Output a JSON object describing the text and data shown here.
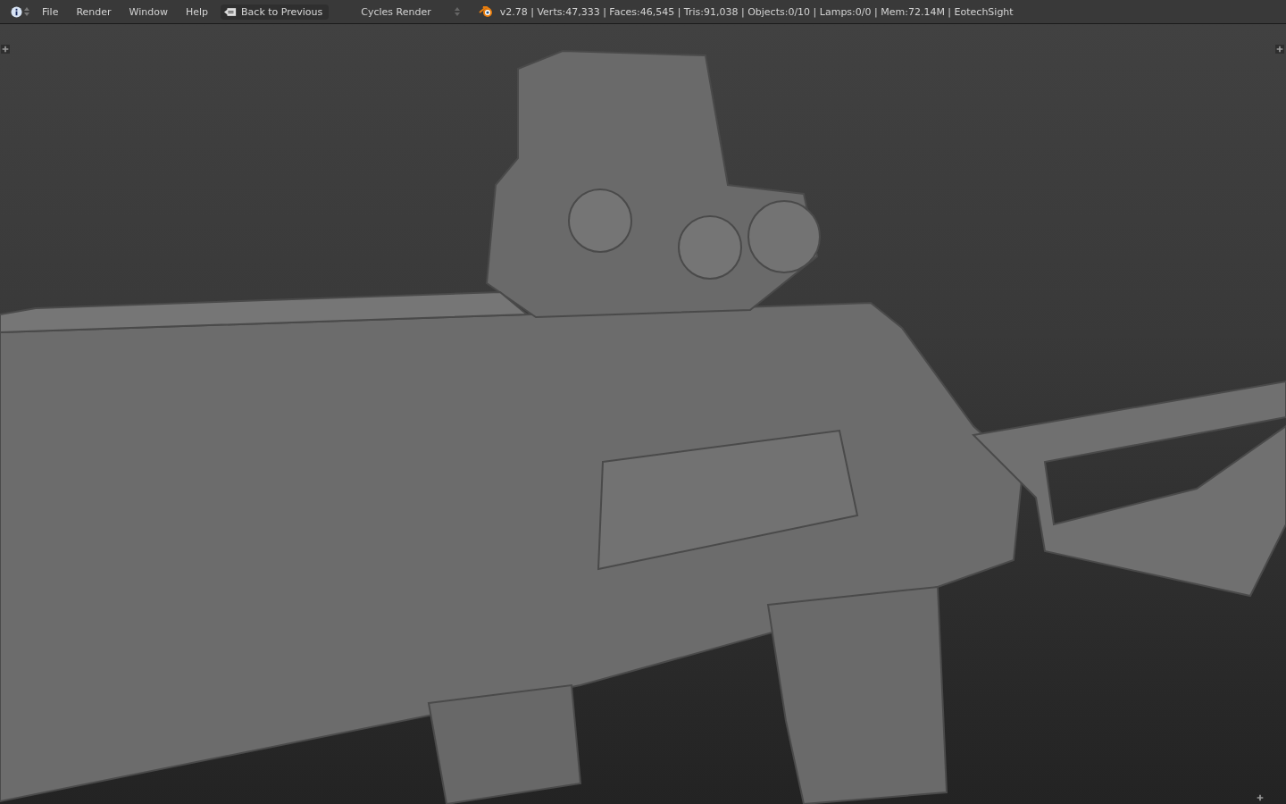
{
  "header": {
    "menus": [
      "File",
      "Render",
      "Window",
      "Help"
    ],
    "back_button": {
      "label": "Back to Previous"
    },
    "render_engine": {
      "value": "Cycles Render"
    },
    "stats": "v2.78 | Verts:47,333 | Faces:46,545 | Tris:91,038 | Objects:0/10 | Lamps:0/0 | Mem:72.14M | EotechSight"
  }
}
